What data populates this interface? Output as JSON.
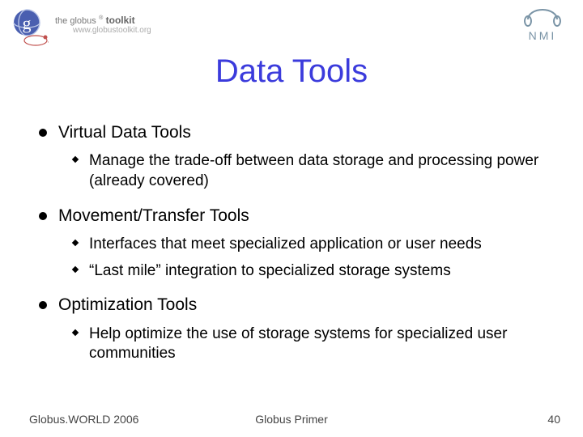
{
  "header": {
    "globus_line1": "the globus",
    "globus_line2": "toolkit",
    "globus_url": "www.globustoolkit.org",
    "nmi_label": "NMI"
  },
  "title": "Data Tools",
  "sections": [
    {
      "heading": "Virtual Data Tools",
      "subs": [
        "Manage the trade-off between data storage and processing power (already covered)"
      ]
    },
    {
      "heading": "Movement/Transfer Tools",
      "subs": [
        "Interfaces that meet specialized application or user needs",
        "“Last mile” integration to specialized storage systems"
      ]
    },
    {
      "heading": "Optimization Tools",
      "subs": [
        "Help optimize the use of storage systems for specialized user communities"
      ]
    }
  ],
  "footer": {
    "left": "Globus.WORLD 2006",
    "center": "Globus Primer",
    "right": "40"
  }
}
